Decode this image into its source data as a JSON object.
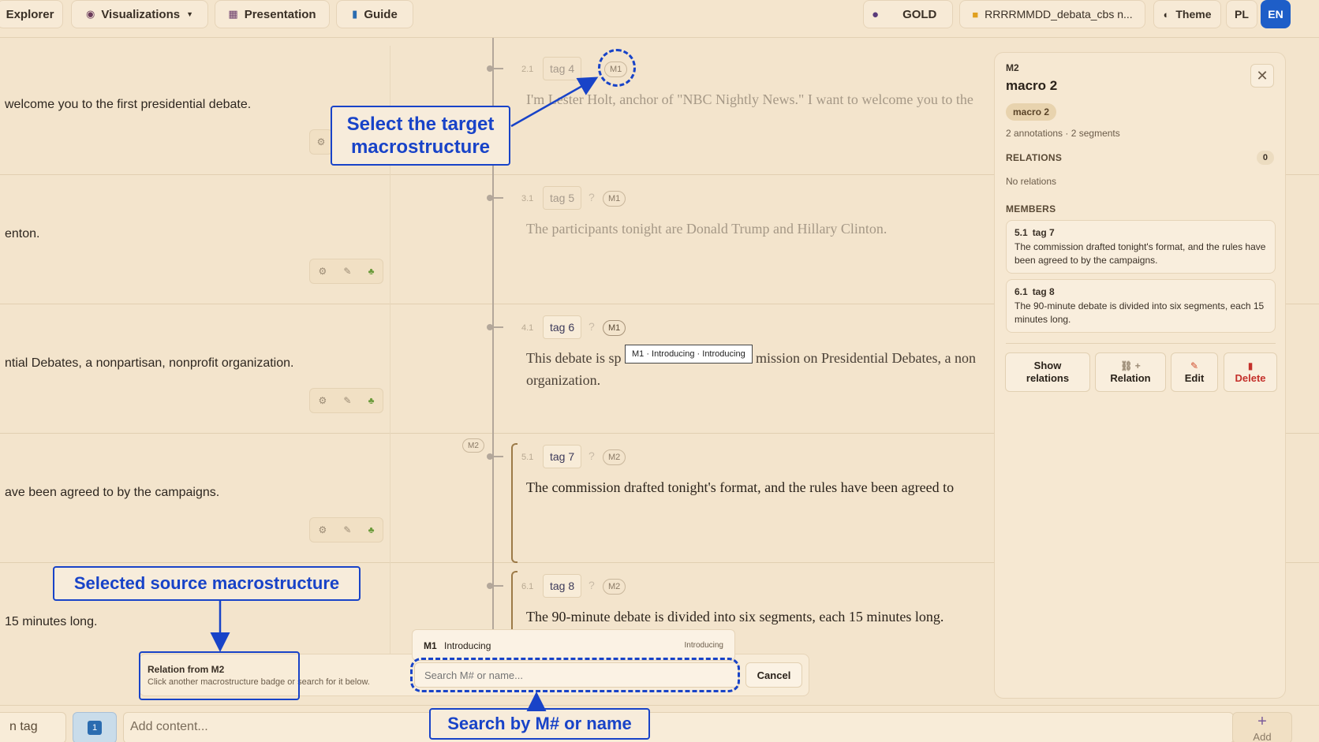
{
  "topbar": {
    "explorer": "Explorer",
    "visualizations": "Visualizations",
    "presentation": "Presentation",
    "guide": "Guide",
    "gold": "GOLD",
    "file": "RRRRMMDD_debata_cbs n...",
    "theme": "Theme",
    "pl": "PL",
    "en": "EN"
  },
  "rows": [
    {
      "left": "welcome you to the first presidential debate.",
      "num": "2.1",
      "tag": "tag 4",
      "macro": "M1",
      "text": "I'm Lester Holt, anchor of \"NBC Nightly News.\" I want to welcome you to the"
    },
    {
      "left": "enton.",
      "num": "3.1",
      "tag": "tag 5",
      "macro": "M1",
      "text": "The participants tonight are Donald Trump and Hillary Clinton."
    },
    {
      "left": "ntial Debates, a nonpartisan, nonprofit organization.",
      "num": "4.1",
      "tag": "tag 6",
      "macro": "M1",
      "text": "This debate is sp",
      "text_after": "mission on Presidential Debates, a non",
      "text2": "organization."
    },
    {
      "left": "ave been agreed to by the campaigns.",
      "num": "5.1",
      "tag": "tag 7",
      "macro": "M2",
      "text": "The commission drafted tonight's format, and the rules have been agreed to"
    },
    {
      "left": "15 minutes long.",
      "num": "6.1",
      "tag": "tag 8",
      "macro": "M2",
      "text": "The 90-minute debate is divided into six segments, each 15 minutes long."
    }
  ],
  "m2_group_badge": "M2",
  "question_mark": "?",
  "tooltip": "M1 · Introducing · Introducing",
  "panel": {
    "id": "M2",
    "title": "macro 2",
    "chip": "macro 2",
    "meta": "2 annotations · 2 segments",
    "relations_label": "RELATIONS",
    "relations_count": "0",
    "no_relations": "No relations",
    "members_label": "MEMBERS",
    "members": [
      {
        "num": "5.1",
        "tag": "tag 7",
        "text": "The commission drafted tonight's format, and the rules have been agreed to by the campaigns."
      },
      {
        "num": "6.1",
        "tag": "tag 8",
        "text": "The 90-minute debate is divided into six segments, each 15 minutes long."
      }
    ],
    "btn_show": "Show relations",
    "btn_relation": "Relation",
    "btn_edit": "Edit",
    "btn_delete": "Delete"
  },
  "relbar": {
    "title": "Relation from M2",
    "subtitle": "Click another macrostructure badge or search for it below.",
    "search_placeholder": "Search M# or name...",
    "cancel": "Cancel"
  },
  "suggestion": {
    "id": "M1",
    "name": "Introducing",
    "right": "Introducing"
  },
  "inputbar": {
    "tag": "n tag",
    "content_placeholder": "Add content...",
    "add": "Add"
  },
  "annotations": {
    "select_target": "Select the target macrostructure",
    "selected_source": "Selected source macrostructure",
    "search_by": "Search by M# or name"
  },
  "colors": {
    "accent": "#1843c8",
    "background": "#f3e4cc",
    "delete": "#c4302b",
    "lang_active": "#1e5ec8"
  }
}
